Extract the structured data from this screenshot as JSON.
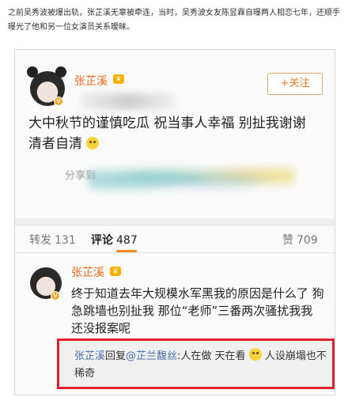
{
  "caption": "之前吴秀波被爆出轨，张芷溪无辜被牵连，当时，吴秀波女友陈昱霖自曝两人相恋七年，还顺手曝光了他和另一位女演员关系暧昧。",
  "post": {
    "username": "张芷溪",
    "follow_label": "+关注",
    "text": "大中秋节的谨慎吃瓜 祝当事人幸福 别扯我谢谢 清者自清",
    "share_label": "分享到"
  },
  "tabs": [
    {
      "label": "转发",
      "count": "131"
    },
    {
      "label": "评论",
      "count": "487"
    },
    {
      "label": "赞",
      "count": "709"
    }
  ],
  "comment": {
    "username": "张芷溪",
    "text": "终于知道去年大规模水军黑我的原因是什么了 狗急跳墙也别扯我 那位“老师”三番两次骚扰我我还没报案呢"
  },
  "reply": {
    "user": "张芷溪",
    "verb": "回复",
    "target": "@芷兰馥丝",
    "text_part1": ":人在做 天在看",
    "text_part2": "人设崩塌也不稀奇"
  },
  "colors": {
    "username": "#e86a1e",
    "accent": "#f08a24",
    "highlight_box": "#e0202c",
    "link": "#4a6fa5"
  }
}
